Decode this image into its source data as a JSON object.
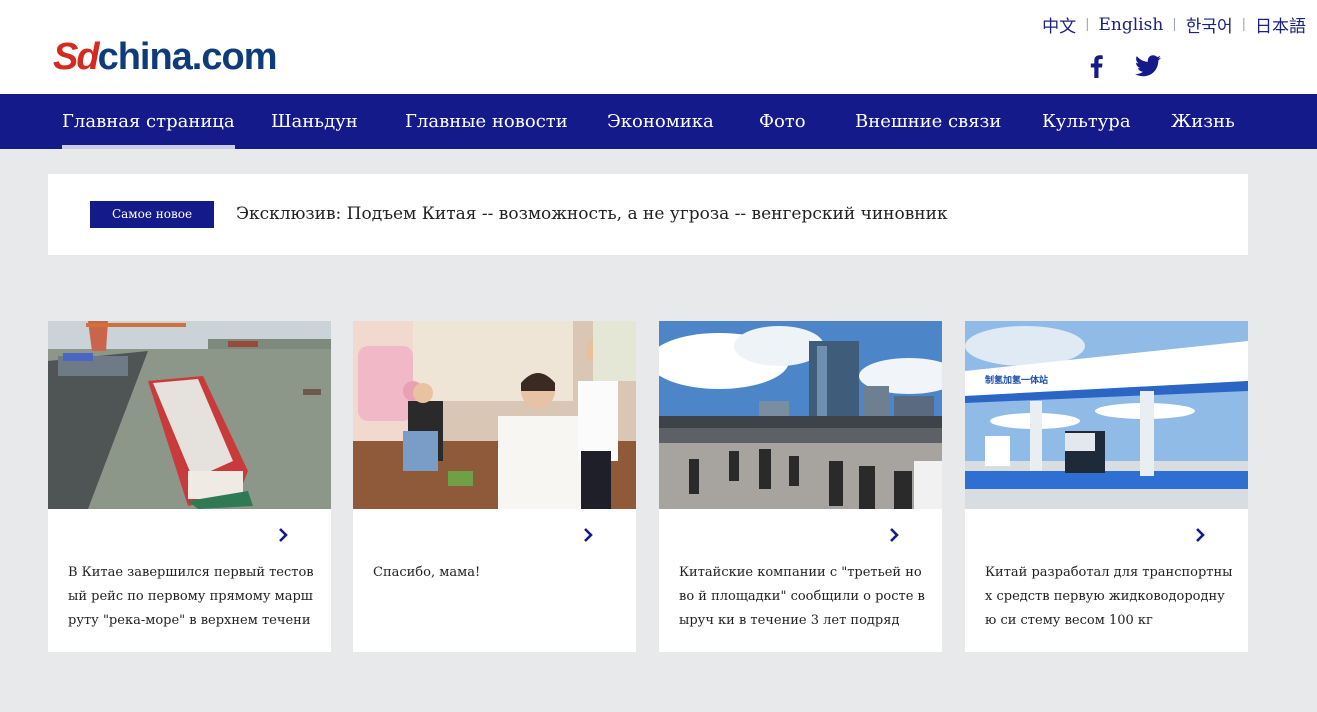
{
  "logo": {
    "part1": "Sd",
    "part2": "china.com"
  },
  "languages": [
    "中文",
    "English",
    "한국어",
    "日本語"
  ],
  "social": {
    "facebook": "facebook-icon",
    "twitter": "twitter-icon"
  },
  "nav": {
    "items": [
      "Главная страница",
      "Шаньдун",
      "Главные новости",
      "Экономика",
      "Фото",
      "Внешние связи",
      "Культура",
      "Жизнь"
    ],
    "active": 0
  },
  "ticker": {
    "badge": "Самое новое",
    "headline": "Эксклюзив: Подъем Китая -- возможность, а не угроза -- венгерский чиновник"
  },
  "cards": [
    {
      "title": "В Китае завершился первый тестовый рейс по первому прямому маршруту \"река-море\" в верхнем течении реки...",
      "image": "cargo-ship-photo",
      "arrow": "chevron-right-icon"
    },
    {
      "title": "Спасибо, мама!",
      "image": "mother-daughter-photo",
      "arrow": "chevron-right-icon"
    },
    {
      "title": "Китайские компании с \"третьей ново й площадки\" сообщили о росте выруч ки в течение 3 лет подряд",
      "image": "city-street-photo",
      "arrow": "chevron-right-icon"
    },
    {
      "title": "Китай разработал для транспортных средств первую жидководородную си стему весом 100 кг",
      "image": "hydrogen-station-photo",
      "arrow": "chevron-right-icon"
    }
  ],
  "colors": {
    "nav_bg": "#141a8a",
    "page_bg": "#e8e9eb",
    "logo_red": "#d42a1f",
    "logo_blue": "#0e3c7a",
    "link_blue": "#1a237e"
  }
}
